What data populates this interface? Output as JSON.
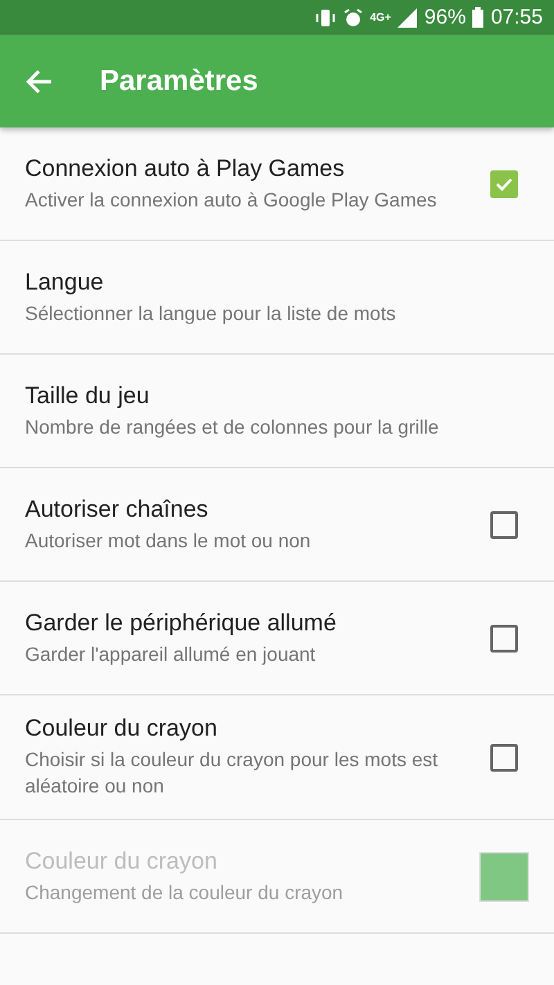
{
  "status_bar": {
    "network": "4G+",
    "battery": "96%",
    "time": "07:55"
  },
  "toolbar": {
    "title": "Paramètres"
  },
  "settings": [
    {
      "kind": "checkbox",
      "title": "Connexion auto à Play Games",
      "summary": "Activer la connexion auto à Google Play Games",
      "checked": true,
      "disabled": false
    },
    {
      "kind": "plain",
      "title": "Langue",
      "summary": "Sélectionner la langue pour la liste de mots",
      "disabled": false
    },
    {
      "kind": "plain",
      "title": "Taille du jeu",
      "summary": "Nombre de rangées et de colonnes pour la grille",
      "disabled": false
    },
    {
      "kind": "checkbox",
      "title": "Autoriser chaînes",
      "summary": "Autoriser mot dans le mot ou non",
      "checked": false,
      "disabled": false
    },
    {
      "kind": "checkbox",
      "title": "Garder le périphérique allumé",
      "summary": "Garder l'appareil allumé en jouant",
      "checked": false,
      "disabled": false
    },
    {
      "kind": "checkbox",
      "title": "Couleur du crayon",
      "summary": "Choisir si la couleur du crayon pour les mots est aléatoire ou non",
      "checked": false,
      "disabled": false
    },
    {
      "kind": "color",
      "title": "Couleur du crayon",
      "summary": "Changement de la couleur du crayon",
      "color": "#81c784",
      "disabled": true
    }
  ]
}
